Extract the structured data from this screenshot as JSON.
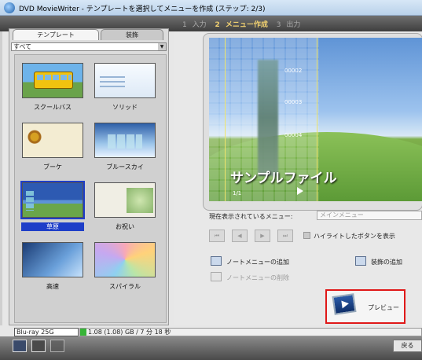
{
  "window": {
    "title": "DVD MovieWriter - テンプレートを選択してメニューを作成 (ステップ: 2/3)"
  },
  "steps": [
    {
      "num": "1",
      "label": "入力",
      "active": false
    },
    {
      "num": "2",
      "label": "メニュー作成",
      "active": true
    },
    {
      "num": "3",
      "label": "出力",
      "active": false
    }
  ],
  "left_panel": {
    "tabs": [
      "テンプレート",
      "装飾"
    ],
    "category_selected": "すべて",
    "templates": [
      {
        "label": "スクールバス",
        "art": "school"
      },
      {
        "label": "ソリッド",
        "art": "solid"
      },
      {
        "label": "ブーケ",
        "art": "bouquet"
      },
      {
        "label": "ブルースカイ",
        "art": "bluesky"
      },
      {
        "label": "草原",
        "art": "grass",
        "selected": true
      },
      {
        "label": "お祝い",
        "art": "celebrate"
      },
      {
        "label": "高速",
        "art": "highway"
      },
      {
        "label": "スパイラル",
        "art": "spiral"
      }
    ]
  },
  "preview": {
    "title": "サンプルファイル",
    "page": "1/1",
    "chapters": [
      "00002",
      "00003",
      "00004"
    ]
  },
  "current_menu": {
    "label": "現在表示されているメニュー:",
    "value": "メインメニュー"
  },
  "nav_buttons": [
    "⏮",
    "◀",
    "▶",
    "⏭"
  ],
  "highlight_label": "ハイライトしたボタンを表示",
  "actions": {
    "add_note_menu": "ノートメニューの追加",
    "delete_note_menu": "ノートメニューの削除",
    "add_decoration": "装飾の追加",
    "preview": "プレビュー"
  },
  "disc": {
    "type": "Blu-ray 25G",
    "capacity": "1.08 (1.08) GB / 7 分 18 秒"
  },
  "bottom": {
    "return_label": "戻る"
  }
}
